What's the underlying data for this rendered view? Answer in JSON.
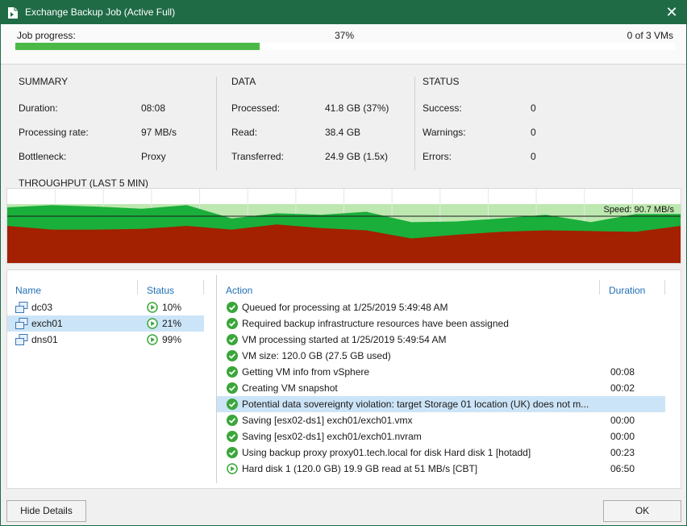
{
  "window": {
    "title": "Exchange Backup Job (Active Full)",
    "close_glyph": "✕"
  },
  "progress": {
    "label": "Job progress:",
    "percent_text": "37%",
    "fraction": 0.37,
    "vms_text": "0 of 3 VMs"
  },
  "summary": {
    "heading": "SUMMARY",
    "rows": [
      {
        "label": "Duration:",
        "value": "08:08"
      },
      {
        "label": "Processing rate:",
        "value": "97 MB/s"
      },
      {
        "label": "Bottleneck:",
        "value": "Proxy"
      }
    ]
  },
  "data": {
    "heading": "DATA",
    "rows": [
      {
        "label": "Processed:",
        "value": "41.8 GB (37%)"
      },
      {
        "label": "Read:",
        "value": "38.4 GB"
      },
      {
        "label": "Transferred:",
        "value": "24.9 GB (1.5x)"
      }
    ]
  },
  "status": {
    "heading": "STATUS",
    "rows": [
      {
        "label": "Success:",
        "value": "0"
      },
      {
        "label": "Warnings:",
        "value": "0"
      },
      {
        "label": "Errors:",
        "value": "0"
      }
    ]
  },
  "throughput": {
    "title": "THROUGHPUT (LAST 5 MIN)",
    "speed_label": "Speed: 90.7 MB/s",
    "colors": {
      "read": "#1aaf3a",
      "transferred": "#a32000",
      "background_band": "#bde8b0",
      "grid": "#e6e6e6",
      "speed_line": "#1a1a1a"
    },
    "speed_level": 0.63,
    "read_series": [
      0.75,
      0.78,
      0.76,
      0.73,
      0.78,
      0.6,
      0.67,
      0.65,
      0.69,
      0.55,
      0.56,
      0.6,
      0.65,
      0.55,
      0.66,
      0.66
    ],
    "transferred_series": [
      0.5,
      0.45,
      0.45,
      0.46,
      0.5,
      0.45,
      0.52,
      0.47,
      0.44,
      0.33,
      0.38,
      0.42,
      0.44,
      0.43,
      0.42,
      0.5
    ]
  },
  "vm_list": {
    "headers": {
      "name": "Name",
      "status": "Status"
    },
    "items": [
      {
        "name": "dc03",
        "percent": "10%",
        "selected": false
      },
      {
        "name": "exch01",
        "percent": "21%",
        "selected": true
      },
      {
        "name": "dns01",
        "percent": "99%",
        "selected": false
      }
    ]
  },
  "actions": {
    "headers": {
      "action": "Action",
      "duration": "Duration"
    },
    "items": [
      {
        "text": "Queued for processing at 1/25/2019 5:49:48 AM",
        "duration": "",
        "icon": "success-icon",
        "selected": false
      },
      {
        "text": "Required backup infrastructure resources have been assigned",
        "duration": "",
        "icon": "success-icon",
        "selected": false
      },
      {
        "text": "VM processing started at 1/25/2019 5:49:54 AM",
        "duration": "",
        "icon": "success-icon",
        "selected": false
      },
      {
        "text": "VM size: 120.0 GB (27.5 GB used)",
        "duration": "",
        "icon": "success-icon",
        "selected": false
      },
      {
        "text": "Getting VM info from vSphere",
        "duration": "00:08",
        "icon": "success-icon",
        "selected": false
      },
      {
        "text": "Creating VM snapshot",
        "duration": "00:02",
        "icon": "success-icon",
        "selected": false
      },
      {
        "text": "Potential data sovereignty violation: target Storage 01 location (UK) does not m...",
        "duration": "",
        "icon": "success-icon",
        "selected": true
      },
      {
        "text": "Saving [esx02-ds1] exch01/exch01.vmx",
        "duration": "00:00",
        "icon": "success-icon",
        "selected": false
      },
      {
        "text": "Saving [esx02-ds1] exch01/exch01.nvram",
        "duration": "00:00",
        "icon": "success-icon",
        "selected": false
      },
      {
        "text": "Using backup proxy proxy01.tech.local for disk Hard disk 1 [hotadd]",
        "duration": "00:23",
        "icon": "success-icon",
        "selected": false
      },
      {
        "text": "Hard disk 1 (120.0 GB) 19.9 GB read at 51 MB/s [CBT]",
        "duration": "06:50",
        "icon": "running-icon",
        "selected": false
      }
    ]
  },
  "footer": {
    "hide_details": "Hide Details",
    "ok": "OK"
  }
}
